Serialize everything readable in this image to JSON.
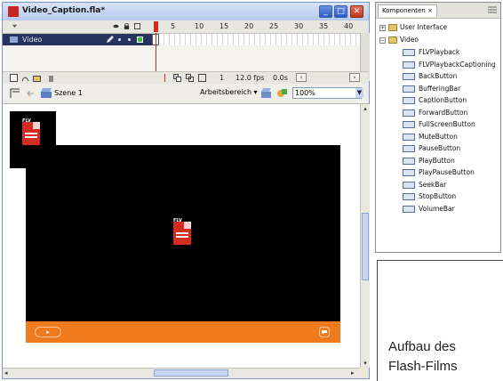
{
  "window": {
    "title": "Video_Caption.fla*",
    "buttons": {
      "minimize": "_",
      "maximize": "□",
      "close": "✕"
    }
  },
  "timeline": {
    "frame_numbers": [
      "5",
      "10",
      "15",
      "20",
      "25",
      "30",
      "35",
      "40"
    ],
    "layer_name": "Video",
    "current_frame": "1",
    "fps": "12.0 fps",
    "time": "0.0s"
  },
  "editbar": {
    "scene": "Szene 1",
    "workspace": "Arbeitsbereich ▾",
    "zoom": "100%"
  },
  "stage": {
    "symbol_label": "FLV",
    "video_label": "FLV",
    "play_glyph": "▸"
  },
  "components": {
    "tab": "Komponenten ×",
    "groups": [
      {
        "label": "User Interface",
        "expander": "+"
      },
      {
        "label": "Video",
        "expander": "−"
      }
    ],
    "items": [
      "FLVPlayback",
      "FLVPlaybackCaptioning",
      "BackButton",
      "BufferingBar",
      "CaptionButton",
      "ForwardButton",
      "FullScreenButton",
      "MuteButton",
      "PauseButton",
      "PlayButton",
      "PlayPauseButton",
      "SeekBar",
      "StopButton",
      "VolumeBar"
    ]
  },
  "caption": {
    "line1": "Aufbau des",
    "line2": "Flash-Films"
  },
  "colors": {
    "accent": "#f07a1e",
    "stage_video": "#000000",
    "flv_icon": "#d42c20"
  }
}
